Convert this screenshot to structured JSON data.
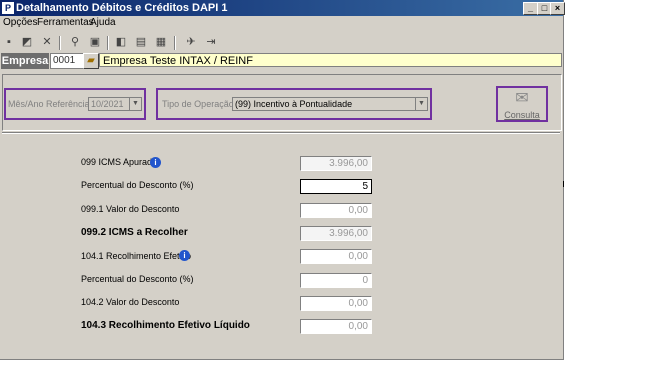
{
  "window": {
    "app_icon": "P",
    "title": "Detalhamento Débitos e Créditos DAPI 1",
    "controls": [
      "_",
      "□",
      "×"
    ]
  },
  "menu": [
    "Opções",
    "Ferramentas",
    "Ajuda"
  ],
  "toolbar_icons": [
    "new-icon",
    "edit-icon",
    "delete-icon",
    "search-icon",
    "save-icon",
    "copy-icon",
    "print-icon",
    "report-icon",
    "tools-icon",
    "exit-icon"
  ],
  "empresa": {
    "label": "Empresa",
    "code": "0001",
    "name": "Empresa Teste INTAX / REINF"
  },
  "filters": {
    "ref_label": "Mês/Ano Referência",
    "ref_value": "10/2021",
    "op_label": "Tipo de Operação",
    "op_value": "(99) Incentivo à Pontualidade",
    "consulta_label": "Consulta"
  },
  "rows": [
    {
      "label": "099 ICMS Apurado",
      "value": "3.996,00"
    },
    {
      "label": "Percentual do Desconto (%)",
      "value": "5"
    },
    {
      "label": "099.1 Valor do Desconto",
      "value": "0,00"
    },
    {
      "label": "099.2 ICMS a Recolher",
      "value": "3.996,00"
    },
    {
      "label": "104.1 Recolhimento Efetivo",
      "value": "0,00"
    },
    {
      "label": "Percentual do Desconto (%)",
      "value": "0"
    },
    {
      "label": "104.2 Valor do Desconto",
      "value": "0,00"
    },
    {
      "label": "104.3 Recolhimento Efetivo Líquido",
      "value": "0,00"
    }
  ],
  "colors": {
    "title_bar": "#0a246a",
    "highlight": "#7030a0",
    "window_bg": "#d4d0c8"
  }
}
